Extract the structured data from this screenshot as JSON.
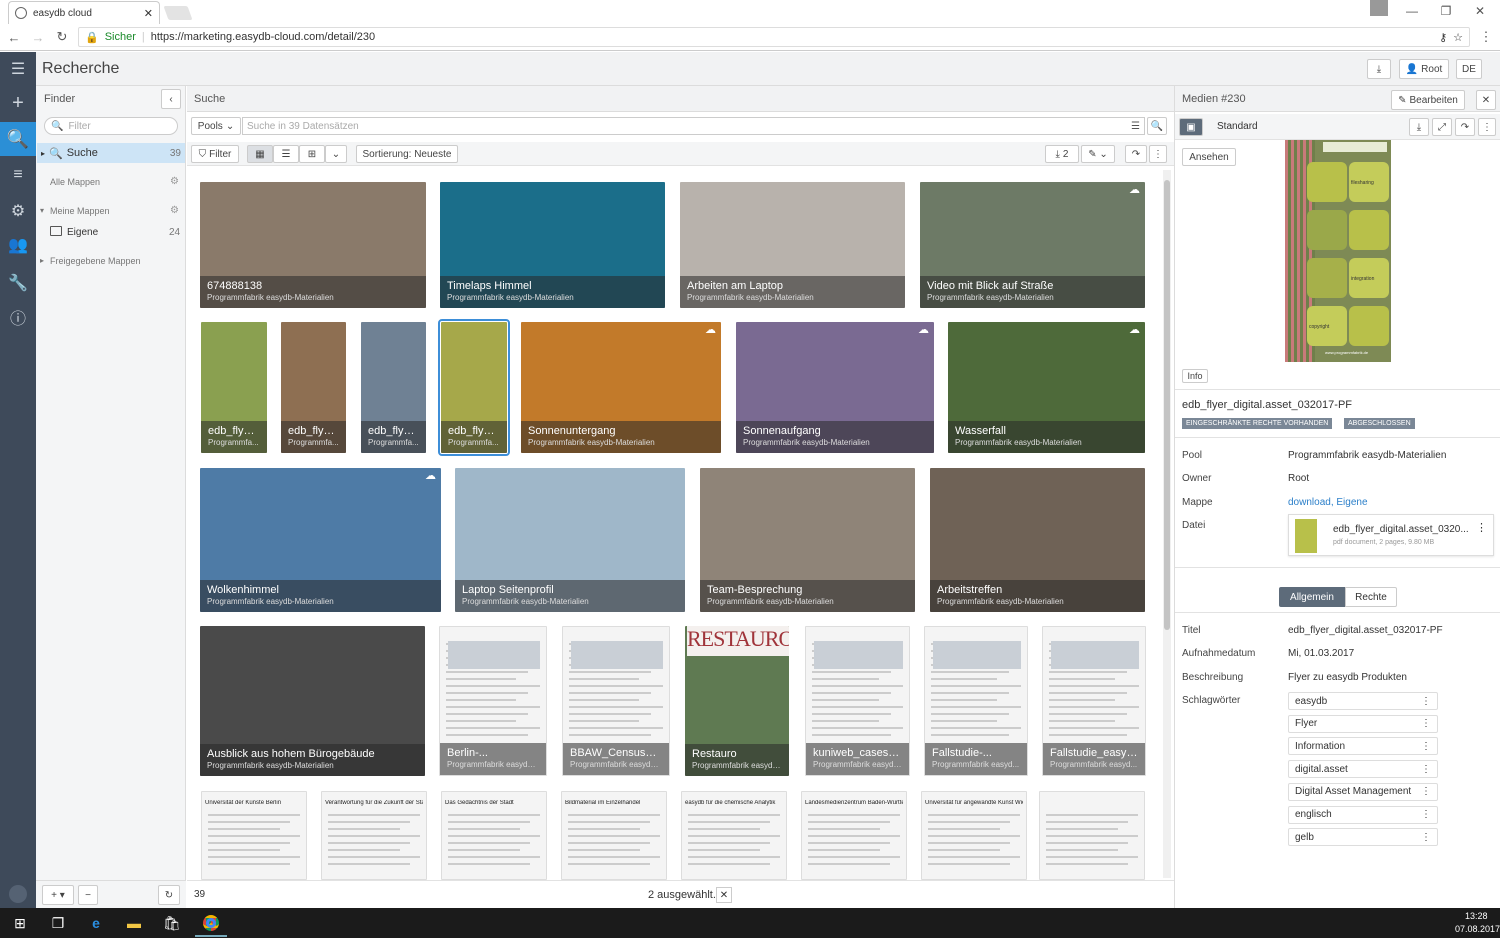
{
  "browser": {
    "tab_title": "easydb cloud",
    "secure_label": "Sicher",
    "url": "https://marketing.easydb-cloud.com/detail/230"
  },
  "header": {
    "title": "Recherche",
    "root_label": "Root",
    "lang_label": "DE"
  },
  "finder": {
    "title": "Finder",
    "filter_placeholder": "Filter",
    "search_label": "Suche",
    "search_count": "39",
    "all_folders": "Alle Mappen",
    "my_folders": "Meine Mappen",
    "own_folder": "Eigene",
    "own_count": "24",
    "shared_folders": "Freigegebene Mappen"
  },
  "search": {
    "title": "Suche",
    "pools_label": "Pools",
    "placeholder": "Suche in 39 Datensätzen",
    "filter_label": "Filter",
    "sort_label": "Sortierung: Neueste",
    "download_count": "2",
    "total": "39",
    "selected_label": "2 ausgewählt."
  },
  "tiles": [
    {
      "title": "674888138",
      "pool": "Programmfabrik easydb-Materialien",
      "color": "#8a7a6a"
    },
    {
      "title": "Timelaps Himmel",
      "pool": "Programmfabrik easydb-Materialien",
      "color": "#1b6e8a"
    },
    {
      "title": "Arbeiten am Laptop",
      "pool": "Programmfabrik easydb-Materialien",
      "color": "#b8b2ac"
    },
    {
      "title": "Video mit Blick auf Straße",
      "pool": "Programmfabrik easydb-Materialien",
      "color": "#6d7a66"
    },
    {
      "title": "edb_flyer...",
      "pool": "Programmfa...",
      "color": "#8aa050"
    },
    {
      "title": "edb_flyer...",
      "pool": "Programmfa...",
      "color": "#8e6f52"
    },
    {
      "title": "edb_flyer...",
      "pool": "Programmfa...",
      "color": "#6f8194"
    },
    {
      "title": "edb_flyer...",
      "pool": "Programmfa...",
      "color": "#a6a84a"
    },
    {
      "title": "Sonnenuntergang",
      "pool": "Programmfabrik easydb-Materialien",
      "color": "#c27a2a"
    },
    {
      "title": "Sonnenaufgang",
      "pool": "Programmfabrik easydb-Materialien",
      "color": "#7a6a92"
    },
    {
      "title": "Wasserfall",
      "pool": "Programmfabrik easydb-Materialien",
      "color": "#4e6a3a"
    },
    {
      "title": "Wolkenhimmel",
      "pool": "Programmfabrik easydb-Materialien",
      "color": "#4e7ba6"
    },
    {
      "title": "Laptop Seitenprofil",
      "pool": "Programmfabrik easydb-Materialien",
      "color": "#9fb7c9"
    },
    {
      "title": "Team-Besprechung",
      "pool": "Programmfabrik easydb-Materialien",
      "color": "#8f8478"
    },
    {
      "title": "Arbeitstreffen",
      "pool": "Programmfabrik easydb-Materialien",
      "color": "#6f6256"
    },
    {
      "title": "Ausblick aus hohem Bürogebäude",
      "pool": "Programmfabrik easydb-Materialien",
      "color": "#4a4a4a"
    },
    {
      "title": "Berlin-...",
      "pool": "Programmfabrik easydb-...",
      "color": "#e8e8e8"
    },
    {
      "title": "BBAW_Census_Cas...",
      "pool": "Programmfabrik easydb-...",
      "color": "#e8e8e8"
    },
    {
      "title": "Restauro",
      "pool": "Programmfabrik easydb...",
      "color": "#5f7a52"
    },
    {
      "title": "kuniweb_casestud...",
      "pool": "Programmfabrik easydb...",
      "color": "#e8e8e8"
    },
    {
      "title": "Fallstudie-...",
      "pool": "Programmfabrik easyd...",
      "color": "#e8e8e8"
    },
    {
      "title": "Fallstudie_easydb...",
      "pool": "Programmfabrik easyd...",
      "color": "#e8e8e8"
    }
  ],
  "doc_headers": [
    "Universität der Künste Berlin",
    "Verantwortung für die Zukunft der Stadt",
    "Das Gedächtnis der Stadt",
    "Bildmaterial im Einzelhandel",
    "easydb für die chemische Analytik",
    "Landesmedienzentrum Baden-Württemberg",
    "Universität für angewandte Kunst Wien",
    ""
  ],
  "restauro_word": "RESTAURO",
  "detail": {
    "title": "Medien #230",
    "edit_label": "Bearbeiten",
    "mask_label": "Standard",
    "view_label": "Ansehen",
    "info_label": "Info",
    "filename": "edb_flyer_digital.asset_032017-PF",
    "badge1": "EINGESCHRÄNKTE RECHTE VORHANDEN",
    "badge2": "ABGESCHLOSSEN",
    "pool_label": "Pool",
    "pool_value": "Programmfabrik easydb-Materialien",
    "owner_label": "Owner",
    "owner_value": "Root",
    "folder_label": "Mappe",
    "folder_link1": "download",
    "folder_sep": ",",
    "folder_link2": "Eigene",
    "file_label": "Datei",
    "file_name": "edb_flyer_digital.asset_0320...",
    "file_meta": "pdf document,  2 pages,  9.80 MB",
    "tab_general": "Allgemein",
    "tab_rights": "Rechte",
    "title_label": "Titel",
    "title_value": "edb_flyer_digital.asset_032017-PF",
    "date_label": "Aufnahmedatum",
    "date_value": "Mi, 01.03.2017",
    "desc_label": "Beschreibung",
    "desc_value": "Flyer zu easydb Produkten",
    "keywords_label": "Schlagwörter",
    "keywords": [
      "easydb",
      "Flyer",
      "Information",
      "digital.asset",
      "Digital Asset Management",
      "englisch",
      "gelb"
    ],
    "flyer_labels": [
      "filesharing",
      "integration",
      "copyright",
      "www.programmfabrik.de"
    ]
  },
  "taskbar": {
    "time": "13:28",
    "date": "07.08.2017"
  }
}
